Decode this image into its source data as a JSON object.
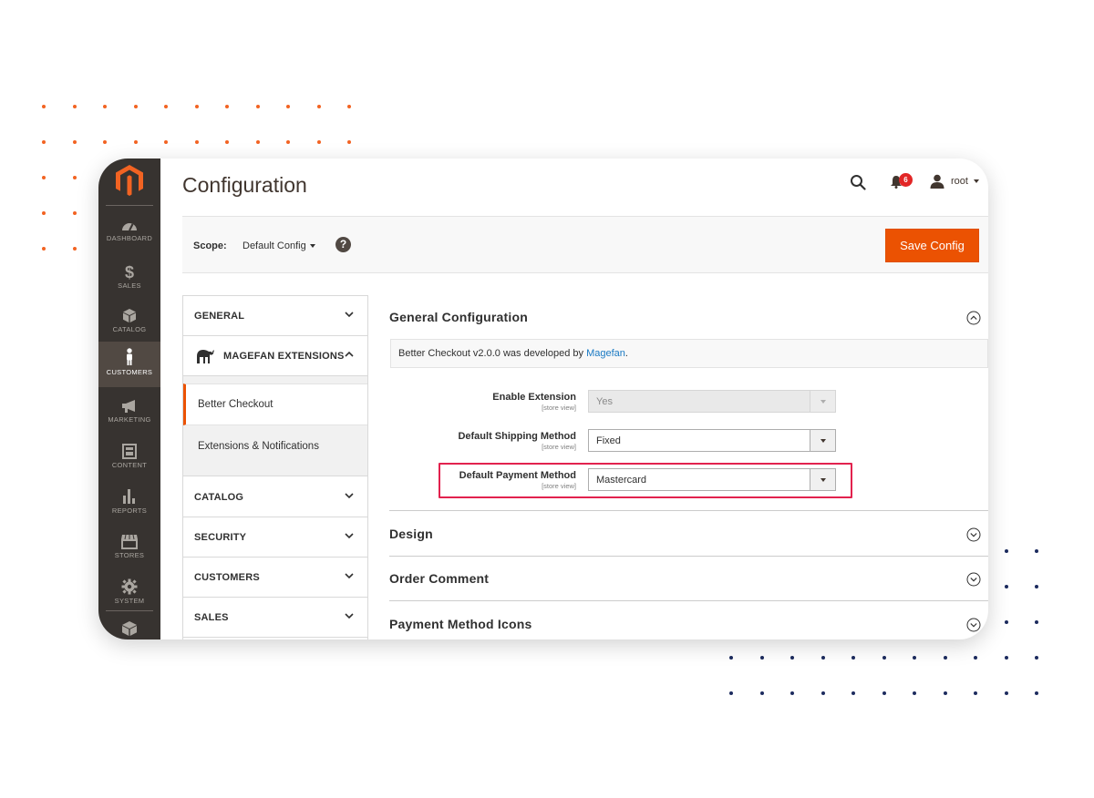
{
  "page": {
    "title": "Configuration"
  },
  "header": {
    "username": "root",
    "notification_count": "6"
  },
  "sidebar": {
    "items": [
      {
        "label": "DASHBOARD",
        "icon": "dashboard-icon"
      },
      {
        "label": "SALES",
        "icon": "dollar-icon"
      },
      {
        "label": "CATALOG",
        "icon": "box-icon"
      },
      {
        "label": "CUSTOMERS",
        "icon": "person-icon"
      },
      {
        "label": "MARKETING",
        "icon": "megaphone-icon"
      },
      {
        "label": "CONTENT",
        "icon": "layout-icon"
      },
      {
        "label": "REPORTS",
        "icon": "bar-chart-icon"
      },
      {
        "label": "STORES",
        "icon": "storefront-icon"
      },
      {
        "label": "SYSTEM",
        "icon": "gear-icon"
      }
    ]
  },
  "scope": {
    "label": "Scope:",
    "value": "Default Config",
    "help": "?"
  },
  "toolbar": {
    "save_label": "Save Config"
  },
  "tabs": {
    "general": "GENERAL",
    "magefan": "MAGEFAN EXTENSIONS",
    "sub_items": [
      "Better Checkout",
      "Extensions & Notifications"
    ],
    "catalog": "CATALOG",
    "security": "SECURITY",
    "customers": "CUSTOMERS",
    "sales": "SALES"
  },
  "general_config": {
    "title": "General Configuration",
    "note_text": "Better Checkout v2.0.0 was developed by ",
    "note_link": "Magefan",
    "note_end": ".",
    "fields": [
      {
        "label": "Enable Extension",
        "scope": "[store view]",
        "value": "Yes"
      },
      {
        "label": "Default Shipping Method",
        "scope": "[store view]",
        "value": "Fixed"
      },
      {
        "label": "Default Payment Method",
        "scope": "[store view]",
        "value": "Mastercard"
      }
    ]
  },
  "sections": [
    "Design",
    "Order Comment",
    "Payment Method Icons"
  ],
  "colors": {
    "accent": "#eb5202",
    "sidebar": "#373330",
    "highlight": "#e2224e",
    "link": "#1979c3"
  }
}
